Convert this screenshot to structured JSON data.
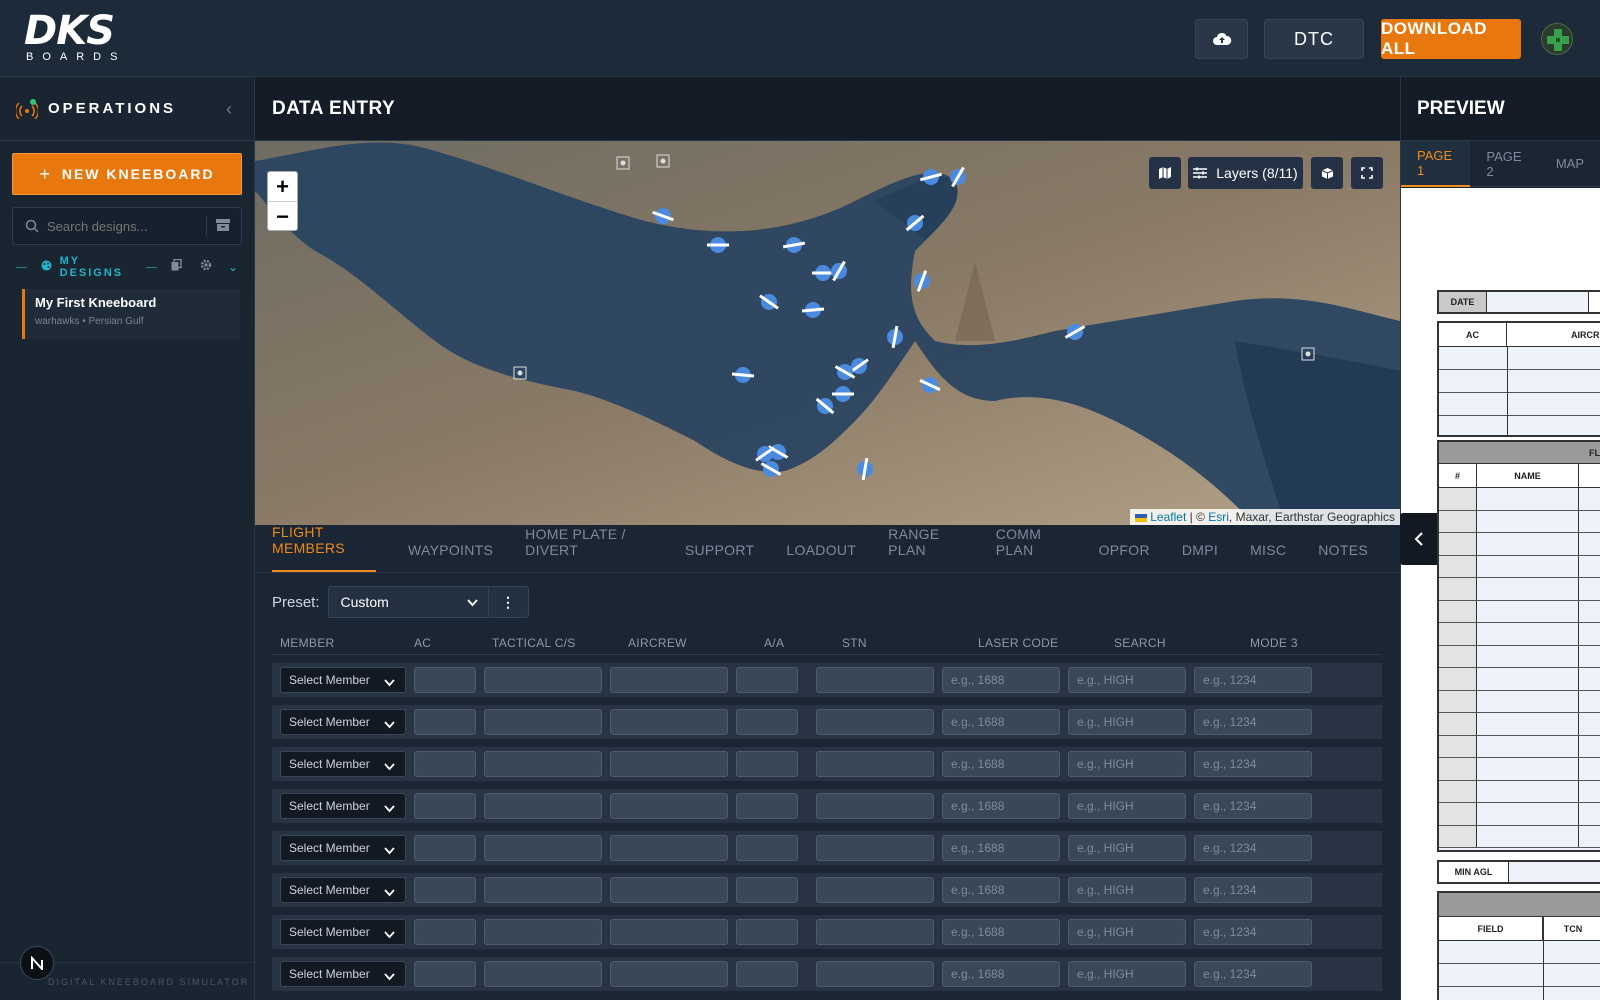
{
  "header": {
    "logo_main": "DKS",
    "logo_sub": "BOARDS",
    "dtc_label": "DTC",
    "download_label": "DOWNLOAD ALL",
    "upload_icon": "cloud-upload-icon",
    "avatar_icon": "green-cross-avatar"
  },
  "sidebar": {
    "title": "OPERATIONS",
    "new_button": "NEW KNEEBOARD",
    "search_placeholder": "Search designs...",
    "section_label": "MY DESIGNS",
    "designs": [
      {
        "name": "My First Kneeboard",
        "sub": "warhawks • Persian Gulf"
      }
    ],
    "footer": "DIGITAL KNEEBOARD SIMULATOR"
  },
  "data_entry": {
    "title": "DATA ENTRY",
    "map": {
      "layers_label": "Layers (8/11)",
      "attribution_leaflet": "Leaflet",
      "attribution_sep": " | © ",
      "attribution_esri": "Esri",
      "attribution_rest": ", Maxar, Earthstar Geographics",
      "zoom_in": "+",
      "zoom_out": "−"
    },
    "tabs": [
      "FLIGHT MEMBERS",
      "WAYPOINTS",
      "HOME PLATE / DIVERT",
      "SUPPORT",
      "LOADOUT",
      "RANGE PLAN",
      "COMM PLAN",
      "OPFOR",
      "DMPI",
      "MISC",
      "NOTES"
    ],
    "active_tab": 0,
    "preset_label": "Preset:",
    "preset_value": "Custom",
    "columns": [
      "MEMBER",
      "AC",
      "TACTICAL C/S",
      "AIRCREW",
      "A/A",
      "STN",
      "LASER CODE",
      "SEARCH",
      "MODE 3"
    ],
    "row_template": {
      "member": "Select Member",
      "laser_placeholder": "e.g., 1688",
      "search_placeholder": "e.g., HIGH",
      "mode3_placeholder": "e.g., 1234"
    },
    "row_count": 8
  },
  "preview": {
    "title": "PREVIEW",
    "tabs": [
      "PAGE 1",
      "PAGE 2",
      "MAP"
    ],
    "active_tab": 0,
    "sheet": {
      "date_label": "DATE",
      "ac_label": "AC",
      "aircrew_label": "AIRCRE",
      "fl_label": "FL",
      "num_label": "#",
      "name_label": "NAME",
      "min_agl_label": "MIN AGL",
      "field_label": "FIELD",
      "tcn_label": "TCN"
    }
  },
  "colors": {
    "accent": "#e8780e",
    "active_tab": "#f08a1c",
    "cyan": "#1fb5cc",
    "bg": "#16202d"
  }
}
